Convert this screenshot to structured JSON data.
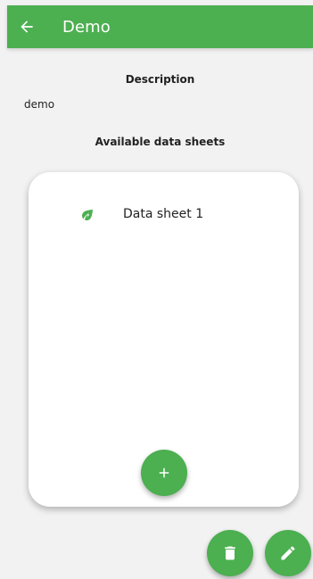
{
  "app_bar": {
    "title": "Demo",
    "back_icon": "arrow-left-icon",
    "background_color": "#4caf50",
    "text_color": "#ffffff"
  },
  "description": {
    "heading": "Description",
    "text": "demo"
  },
  "data_sheets": {
    "heading": "Available data sheets",
    "items": [
      {
        "label": "Data sheet 1",
        "icon": "eco-leaf-bolt-icon"
      }
    ],
    "add_button_icon": "plus-icon"
  },
  "actions": {
    "delete_icon": "trash-icon",
    "edit_icon": "pencil-icon",
    "accent_color": "#4caf50"
  }
}
